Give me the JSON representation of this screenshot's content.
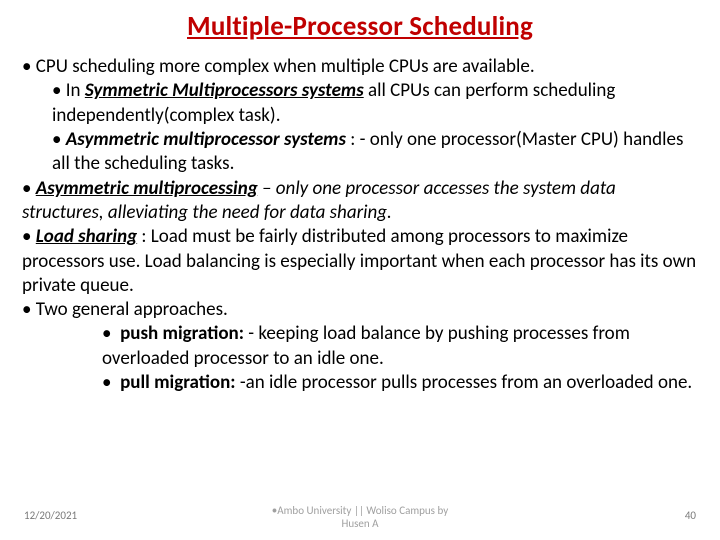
{
  "title": "Multiple-Processor Scheduling",
  "body": {
    "p1": "CPU scheduling more complex when multiple CPUs are available.",
    "p2a": "In ",
    "p2b": "Symmetric Multiprocessors systems",
    "p2c": " all CPUs can perform scheduling independently(complex task).",
    "p3a": "Asymmetric multiprocessor systems",
    "p3b": " : - only one processor(Master CPU) handles all the scheduling tasks.",
    "p4a": "Asymmetric multiprocessing",
    "p4b": " – only one processor accesses the system data structures, alleviating the need for data sharing.",
    "p5a": "Load sharing",
    "p5b": " : Load must be fairly distributed among processors  to maximize processors use. Load balancing is especially important when each  processor has its own private queue.",
    "p6": "Two general approaches.",
    "p7a": "push migration: ",
    "p7b": "- keeping load balance by pushing processes from overloaded processor to an idle one.",
    "p8a": "pull   migration: ",
    "p8b": "-an idle processor pulls processes from an overloaded one."
  },
  "footer": {
    "date": "12/20/2021",
    "center_bullet": "•",
    "center1": "Ambo University || Woliso Campus      by",
    "center2": "Husen A",
    "num": "40"
  }
}
